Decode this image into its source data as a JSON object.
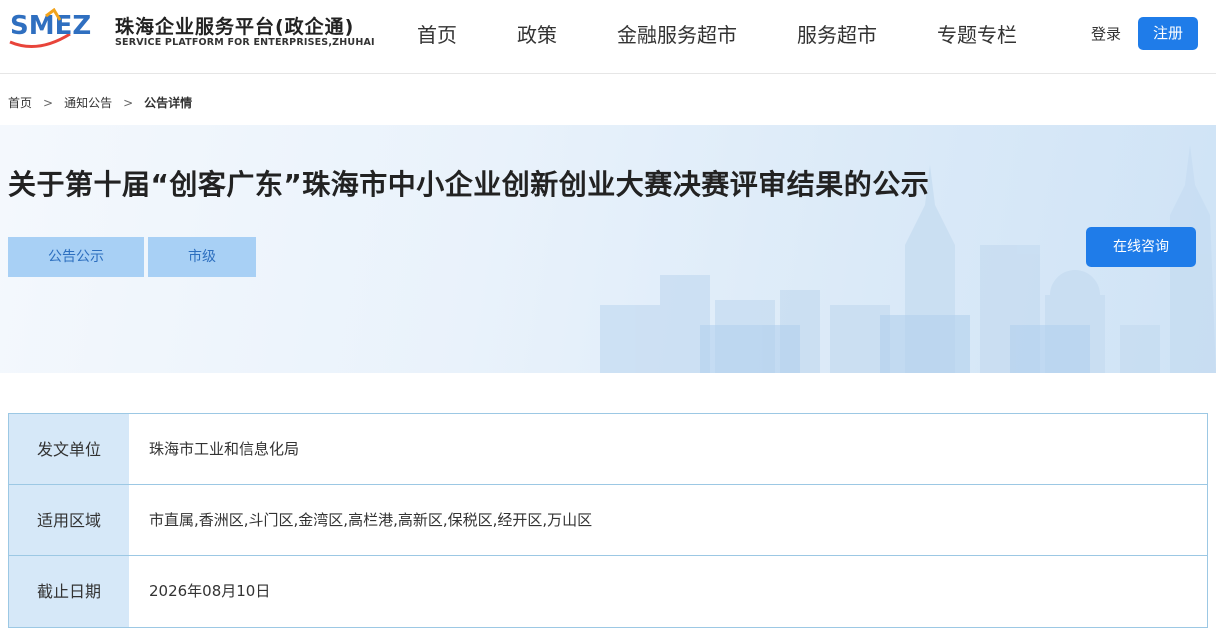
{
  "header": {
    "logo_cn": "珠海企业服务平台(政企通)",
    "logo_en": "SERVICE PLATFORM FOR ENTERPRISES,ZHUHAI",
    "logo_mark_text": "SMEZ",
    "nav": [
      "首页",
      "政策",
      "金融服务超市",
      "服务超市",
      "专题专栏"
    ],
    "login_label": "登录",
    "register_label": "注册"
  },
  "breadcrumb": {
    "items": [
      "首页",
      "通知公告",
      "公告详情"
    ],
    "separator": ">"
  },
  "banner": {
    "title": "关于第十届“创客广东”珠海市中小企业创新创业大赛决赛评审结果的公示",
    "tags": [
      "公告公示",
      "市级"
    ],
    "consult_label": "在线咨询"
  },
  "info": {
    "rows": [
      {
        "label": "发文单位",
        "value": "珠海市工业和信息化局"
      },
      {
        "label": "适用区域",
        "value": "市直属,香洲区,斗门区,金湾区,高栏港,高新区,保税区,经开区,万山区"
      },
      {
        "label": "截止日期",
        "value": "2026年08月10日"
      }
    ]
  },
  "colors": {
    "primary": "#1f7ce9",
    "tag_bg": "#a8d0f5",
    "tag_text": "#2d6fbf",
    "label_bg": "#d6e8f8",
    "border": "#9cc8e4"
  }
}
